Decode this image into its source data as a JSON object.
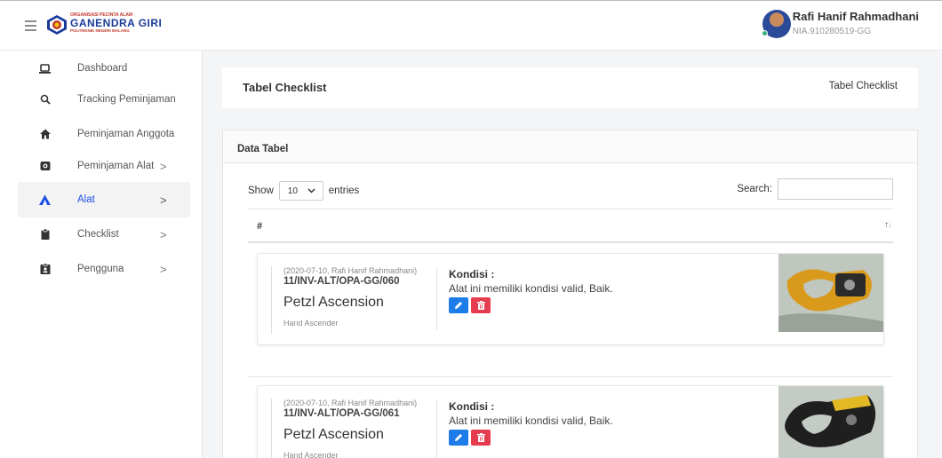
{
  "brand": {
    "top": "ORGANISASI PECINTA ALAM",
    "main": "GANENDRA GIRI",
    "bottom": "POLITEKNIK NEGERI MALANG"
  },
  "user": {
    "name": "Rafi Hanif Rahmadhani",
    "nia": "NIA.910280519-GG"
  },
  "sidebar": {
    "items": [
      {
        "label": "Dashboard",
        "icon": "laptop-icon"
      },
      {
        "label": "Tracking Peminjaman",
        "icon": "search-icon"
      },
      {
        "label": "Peminjaman Anggota",
        "icon": "home-icon"
      },
      {
        "label": "Peminjaman Alat",
        "icon": "box-icon",
        "chevron": ">"
      },
      {
        "label": "Alat",
        "icon": "tent-icon",
        "chevron": ">",
        "active": true
      },
      {
        "label": "Checklist",
        "icon": "clipboard-icon",
        "chevron": ">"
      },
      {
        "label": "Pengguna",
        "icon": "id-card-icon",
        "chevron": ">"
      }
    ]
  },
  "page": {
    "title": "Tabel Checklist",
    "breadcrumb": "Tabel Checklist"
  },
  "card": {
    "title": "Data Tabel",
    "show_label": "Show",
    "entries_value": "10",
    "entries_label": "entries",
    "search_label": "Search:",
    "column_hash": "#",
    "sort_glyph_up": "↑",
    "sort_glyph_down": "↓"
  },
  "rows": [
    {
      "meta": "(2020-07-10, Rafi Hanif Rahmadhani)",
      "code": "11/INV-ALT/OPA-GG/060",
      "name": "Petzl Ascension",
      "category": "Hand Ascender",
      "kondisi_label": "Kondisi :",
      "kondisi_text": "Alat ini memiliki kondisi valid, Baik."
    },
    {
      "meta": "(2020-07-10, Rafi Hanif Rahmadhani)",
      "code": "11/INV-ALT/OPA-GG/061",
      "name": "Petzl Ascension",
      "category": "Hand Ascender",
      "kondisi_label": "Kondisi :",
      "kondisi_text": "Alat ini memiliki kondisi valid, Baik."
    }
  ],
  "colors": {
    "accent": "#1e4ee6",
    "edit": "#1e7ce8",
    "delete": "#e53d4f"
  }
}
